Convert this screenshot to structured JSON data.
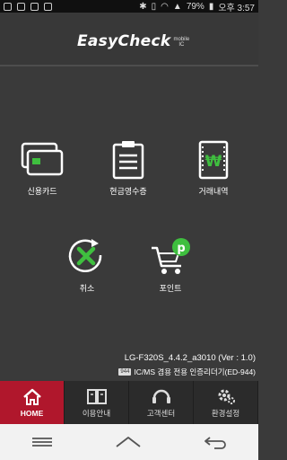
{
  "status_bar": {
    "battery": "79%",
    "time": "오후 3:57"
  },
  "header": {
    "logo_text": "EasyCheck",
    "logo_sub_line1": "mobile",
    "logo_sub_line2": "IC"
  },
  "menu": {
    "credit_card": "신용카드",
    "cash_receipt": "현금영수증",
    "transactions": "거래내역",
    "cancel": "취소",
    "point": "포인트"
  },
  "info": {
    "version": "LG-F320S_4.4.2_a3010 (Ver : 1.0)",
    "cert_badge": "944",
    "cert_text": "IC/MS 겸용 전용 인증리더기(ED-944)"
  },
  "tabs": [
    {
      "label": "HOME"
    },
    {
      "label": "이용안내"
    },
    {
      "label": "고객센터"
    },
    {
      "label": "환경설정"
    }
  ],
  "colors": {
    "accent_green": "#3fbf3f",
    "active_tab": "#b0172c",
    "background": "#3a3a3a"
  }
}
